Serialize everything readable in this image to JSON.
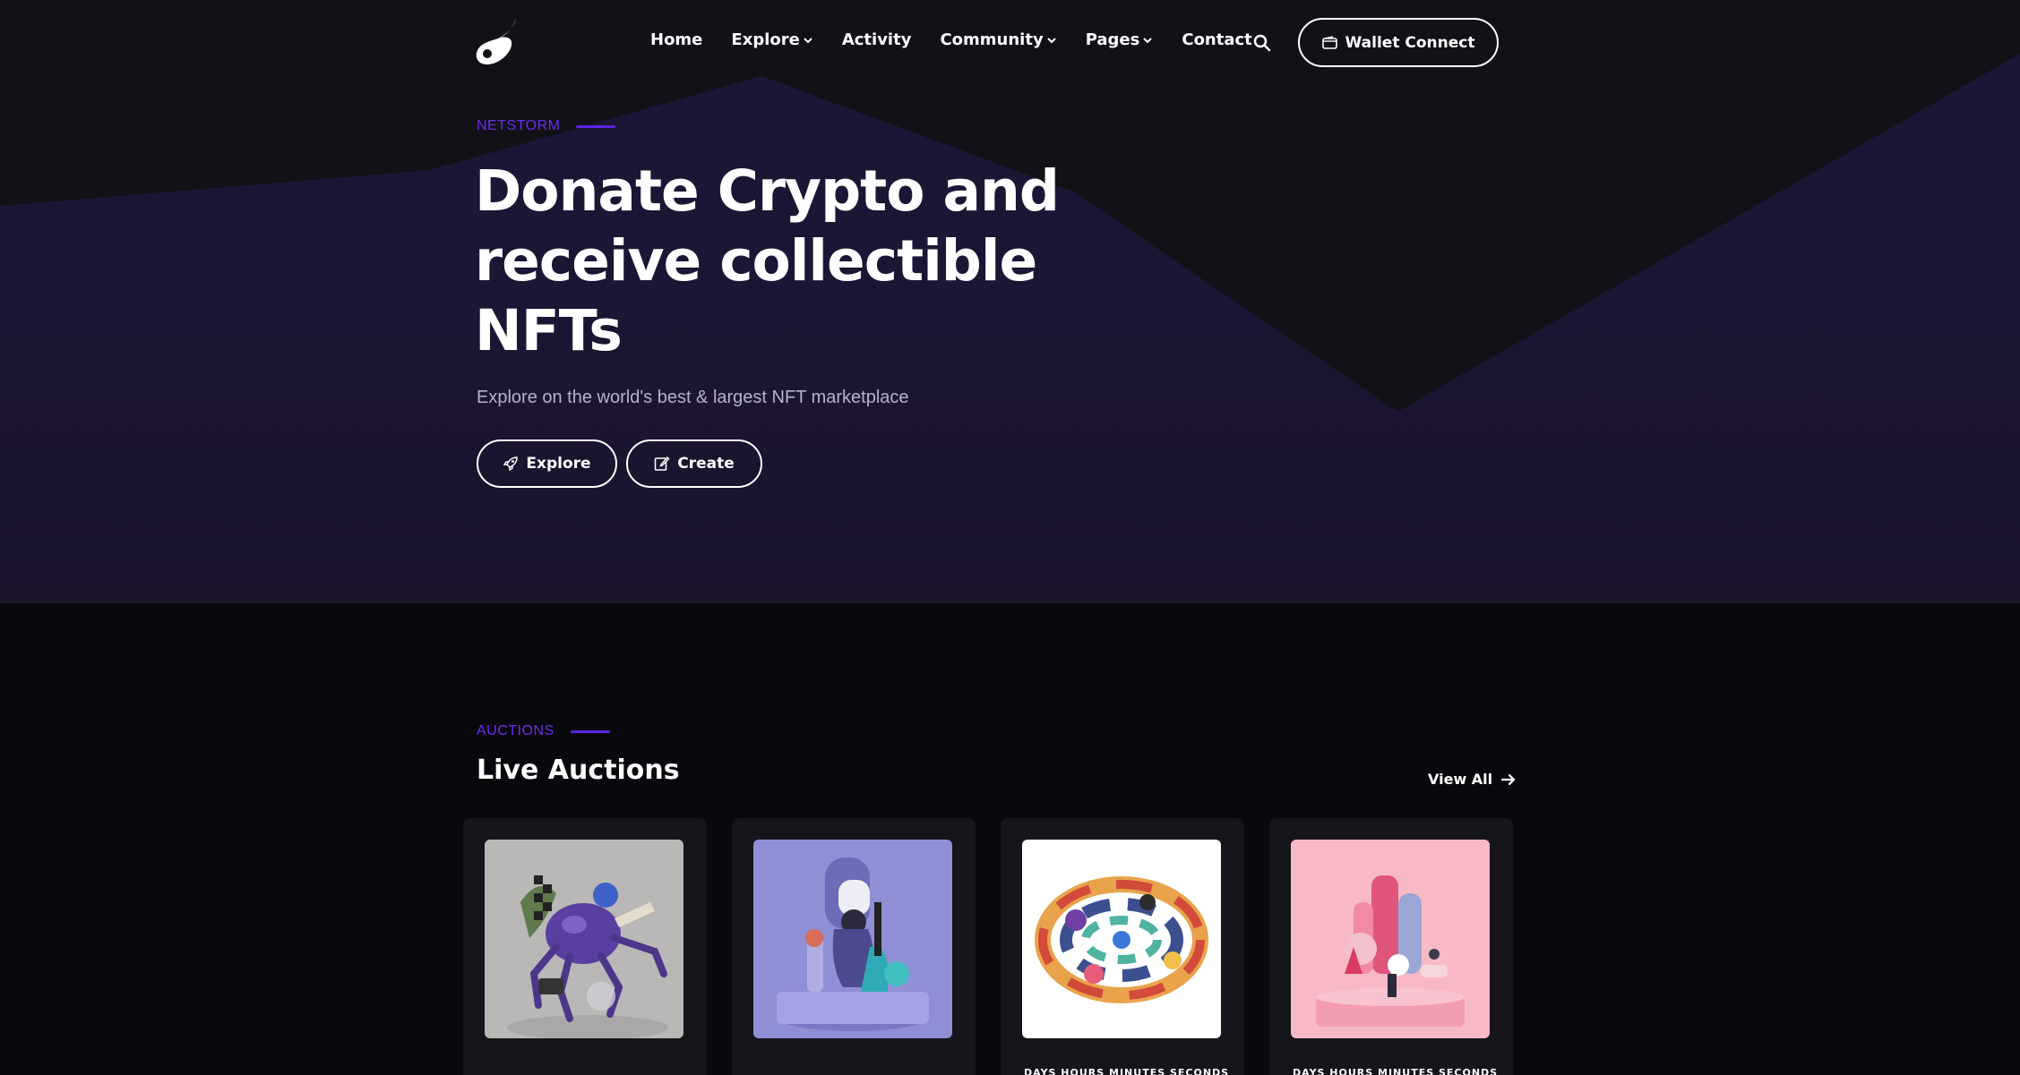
{
  "header": {
    "nav": [
      {
        "label": "Home",
        "dropdown": false
      },
      {
        "label": "Explore",
        "dropdown": true
      },
      {
        "label": "Activity",
        "dropdown": false
      },
      {
        "label": "Community",
        "dropdown": true
      },
      {
        "label": "Pages",
        "dropdown": true
      },
      {
        "label": "Contact",
        "dropdown": false
      }
    ],
    "wallet_label": "Wallet Connect"
  },
  "hero": {
    "eyebrow": "NETSTORM",
    "title_lines": [
      "Donate Crypto and",
      "receive collectible",
      "NFTs"
    ],
    "subtitle": "Explore on the world's best & largest NFT marketplace",
    "explore_label": "Explore",
    "create_label": "Create"
  },
  "auctions": {
    "eyebrow": "AUCTIONS",
    "title": "Live Auctions",
    "view_all_label": "View All",
    "cards": [
      {
        "image": "purple-spider-3d-art",
        "bg": "#b9b8b6",
        "countdown": ""
      },
      {
        "image": "robot-on-pedestal-3d-art",
        "bg": "#8f8fd6",
        "countdown": ""
      },
      {
        "image": "colorful-swirl-3d-art",
        "bg": "#ffffff",
        "countdown": "DAYS  HOURS  MINUTES  SECONDS"
      },
      {
        "image": "pink-sculpture-3d-art",
        "bg": "#f8b9c6",
        "countdown": "DAYS  HOURS  MINUTES  SECONDS"
      }
    ]
  },
  "colors": {
    "accent": "#6a2cf0",
    "hero_bg": "#1d1638",
    "page_bg": "#09080d"
  }
}
